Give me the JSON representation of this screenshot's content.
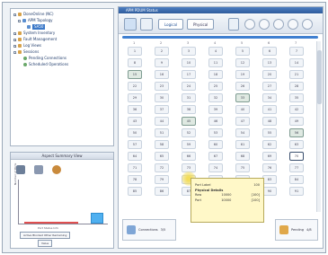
{
  "colors": {
    "accent": "#3f7fd0",
    "titlebar": "#2f5c9c",
    "tooltip_bg": "#fff8c8",
    "highlight": "#dfe9e2"
  },
  "tree": {
    "items": [
      {
        "label": "DoneOnline (NC)",
        "icon": "folder-icon"
      },
      {
        "label": "APM Topology",
        "icon": "topology-icon"
      },
      {
        "label": "SA50",
        "icon": "device-icon",
        "selected": true
      },
      {
        "label": "System Inventory",
        "icon": "folder-icon"
      },
      {
        "label": "Fault Management",
        "icon": "folder-icon"
      },
      {
        "label": "Log Views",
        "icon": "folder-icon"
      },
      {
        "label": "Sessions",
        "icon": "folder-icon"
      },
      {
        "label": "Pending Connections",
        "icon": "status-icon"
      },
      {
        "label": "Scheduled Operations",
        "icon": "status-icon"
      }
    ]
  },
  "stats_panel": {
    "title": "Aspect Summary View",
    "y_label": "Number of Ports",
    "x_label": "Port Status Info",
    "legend_label": "Active   Blocked   Other   Remaining",
    "select_value": "Value"
  },
  "window": {
    "title": "APM PDUM Status",
    "tabs": [
      "Logical",
      "Physical"
    ]
  },
  "grid": {
    "columns": [
      "1",
      "2",
      "3",
      "4",
      "5",
      "6",
      "7"
    ],
    "rows": [
      [
        "1",
        "2",
        "3",
        "4",
        "5",
        "6",
        "7"
      ],
      [
        "8",
        "9",
        "10",
        "11",
        "12",
        "13",
        "14"
      ],
      [
        "15",
        "16",
        "17",
        "18",
        "19",
        "20",
        "21"
      ],
      [
        "22",
        "23",
        "24",
        "25",
        "26",
        "27",
        "28"
      ],
      [
        "29",
        "30",
        "31",
        "32",
        "33",
        "34",
        "35"
      ],
      [
        "36",
        "37",
        "38",
        "39",
        "40",
        "41",
        "42"
      ],
      [
        "43",
        "44",
        "45",
        "46",
        "47",
        "48",
        "49"
      ],
      [
        "50",
        "51",
        "52",
        "53",
        "54",
        "55",
        "56"
      ],
      [
        "57",
        "58",
        "59",
        "60",
        "61",
        "62",
        "63"
      ],
      [
        "64",
        "65",
        "66",
        "67",
        "68",
        "69",
        "70"
      ],
      [
        "71",
        "72",
        "73",
        "74",
        "75",
        "76",
        "77"
      ],
      [
        "78",
        "79",
        "80",
        "81",
        "82",
        "83",
        "84"
      ],
      [
        "85",
        "86",
        "87",
        "88",
        "89",
        "90",
        "91"
      ]
    ],
    "highlighted": [
      "15",
      "33",
      "45",
      "56"
    ],
    "selected": [
      "70"
    ]
  },
  "tooltip": {
    "port_label": "Port Label",
    "port_value": "100",
    "section": "Physical Details",
    "row_label": "Row",
    "row_value": "10000",
    "row_extra": "[100]",
    "port_label2": "Port",
    "port_value2": "10000",
    "port_extra": "[100]"
  },
  "status": {
    "connections_label": "Connections",
    "connections_value": "3/5",
    "pending_label": "Pending",
    "pending_value": "4/8"
  }
}
